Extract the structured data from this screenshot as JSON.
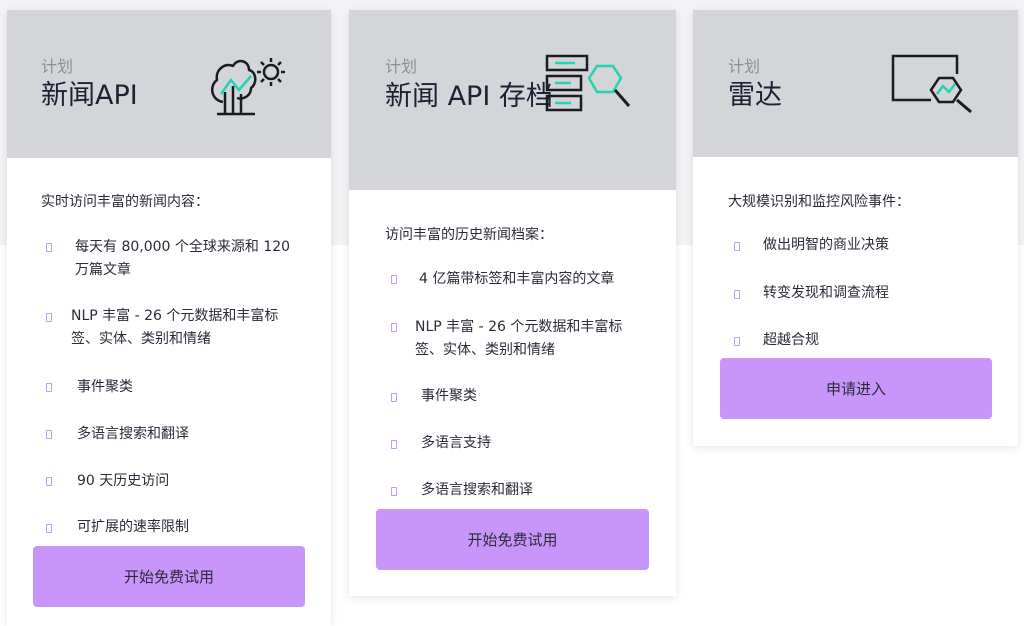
{
  "colors": {
    "header_bg": "#d3d5d8",
    "button_bg": "#c896fb",
    "accent_teal": "#22d3b4",
    "bullet": "#c39bf0"
  },
  "cards": [
    {
      "label": "计划",
      "title": "新闻API",
      "icon": "tree-gear-icon",
      "intro": "实时访问丰富的新闻内容：",
      "features": [
        "每天有 80,000 个全球来源和 120 万篇文章",
        "NLP 丰富 - 26 个元数据和丰富标签、实体、类别和情绪",
        "事件聚类",
        "多语言搜索和翻译",
        "90 天历史访问",
        "可扩展的速率限制"
      ],
      "button": "开始免费试用"
    },
    {
      "label": "计划",
      "title": "新闻 API 存档",
      "icon": "server-search-icon",
      "intro": "访问丰富的历史新闻档案：",
      "features": [
        "4 亿篇带标签和丰富内容的文章",
        "NLP 丰富 - 26 个元数据和丰富标签、实体、类别和情绪",
        "事件聚类",
        "多语言支持",
        "多语言搜索和翻译"
      ],
      "button": "开始免费试用"
    },
    {
      "label": "计划",
      "title": "雷达",
      "icon": "monitor-search-icon",
      "intro": "大规模识别和监控风险事件：",
      "features": [
        "做出明智的商业决策",
        "转变发现和调查流程",
        "超越合规"
      ],
      "button": "申请进入"
    }
  ]
}
